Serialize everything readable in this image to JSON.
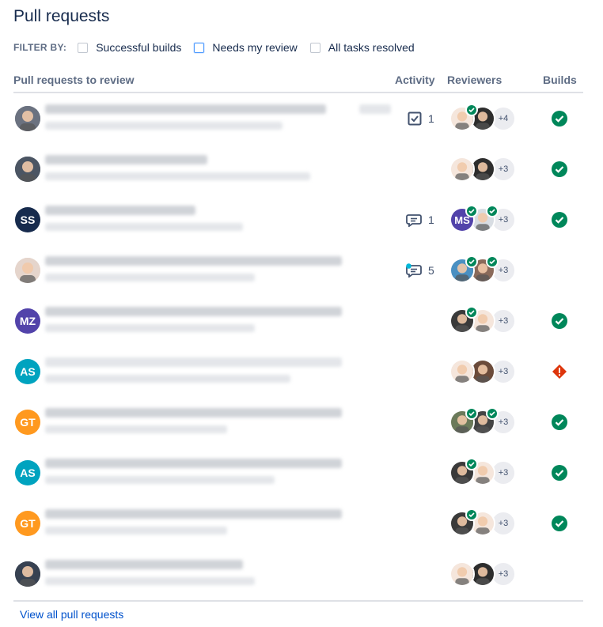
{
  "title": "Pull requests",
  "filter": {
    "label": "FILTER BY:",
    "options": [
      {
        "label": "Successful builds",
        "checked": false
      },
      {
        "label": "Needs my review",
        "checked": false
      },
      {
        "label": "All tasks resolved",
        "checked": false
      }
    ]
  },
  "table": {
    "columns": [
      "Pull requests to review",
      "Activity",
      "Reviewers",
      "Builds"
    ],
    "rows": [
      {
        "author_initials": "",
        "author_color": "#6b7280",
        "activity": {
          "icon": "task-icon",
          "count": "1"
        },
        "reviewers_more": "+4",
        "build": "success"
      },
      {
        "author_initials": "",
        "author_color": "#4b5563",
        "activity": null,
        "reviewers_more": "+3",
        "build": "success"
      },
      {
        "author_initials": "SS",
        "author_color": "#172b4d",
        "activity": {
          "icon": "comment-icon",
          "count": "1"
        },
        "reviewers_more": "+3",
        "build": "success"
      },
      {
        "author_initials": "",
        "author_color": "#e5d5cc",
        "activity": {
          "icon": "comment-unread-icon",
          "count": "5"
        },
        "reviewers_more": "+3",
        "build": ""
      },
      {
        "author_initials": "MZ",
        "author_color": "#5243aa",
        "activity": null,
        "reviewers_more": "+3",
        "build": "success"
      },
      {
        "author_initials": "AS",
        "author_color": "#00a3bf",
        "activity": null,
        "reviewers_more": "+3",
        "build": "failed"
      },
      {
        "author_initials": "GT",
        "author_color": "#ff991f",
        "activity": null,
        "reviewers_more": "+3",
        "build": "success"
      },
      {
        "author_initials": "AS",
        "author_color": "#00a3bf",
        "activity": null,
        "reviewers_more": "+3",
        "build": "success"
      },
      {
        "author_initials": "GT",
        "author_color": "#ff991f",
        "activity": null,
        "reviewers_more": "+3",
        "build": "success"
      },
      {
        "author_initials": "",
        "author_color": "#374151",
        "activity": null,
        "reviewers_more": "+3",
        "build": ""
      }
    ]
  },
  "footer": {
    "link": "View all pull requests"
  },
  "colors": {
    "success": "#00875a",
    "failed": "#de350b",
    "link": "#0052cc"
  }
}
